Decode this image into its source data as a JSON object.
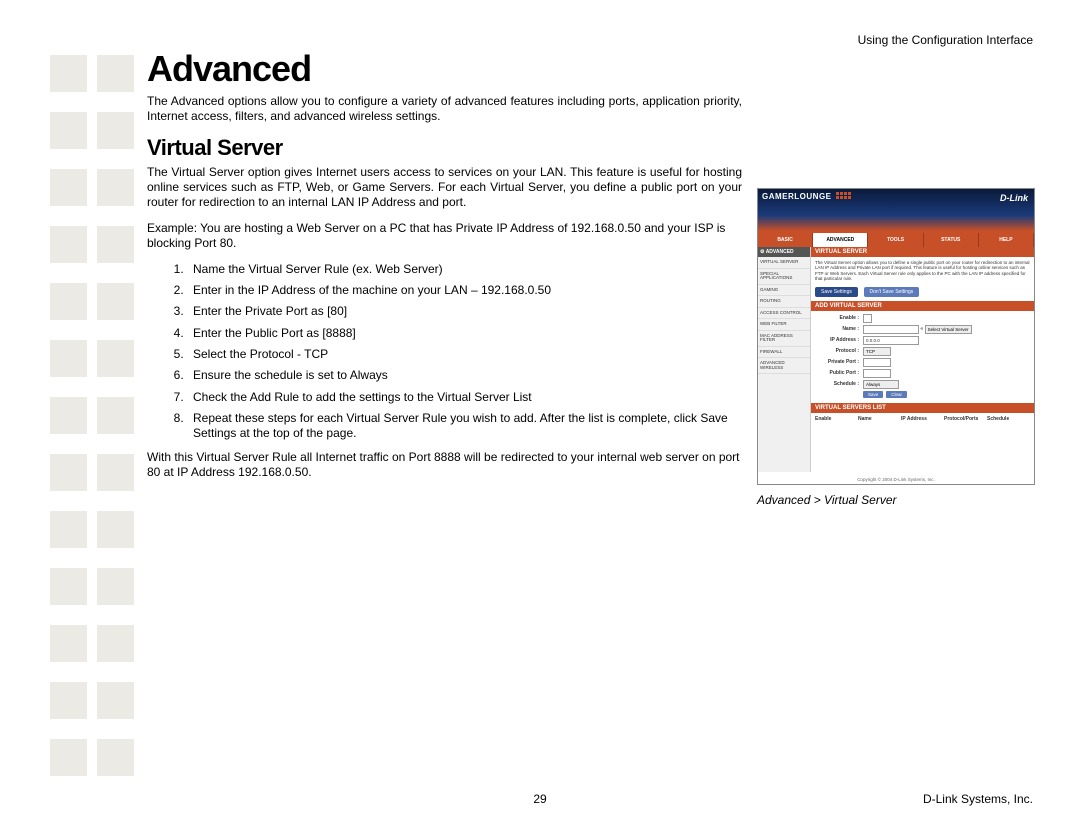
{
  "header": {
    "right": "Using the Configuration Interface"
  },
  "title": "Advanced",
  "intro": "The Advanced options allow you to configure a variety of advanced features including ports, application priority, Internet access, filters, and advanced wireless settings.",
  "section_title": "Virtual Server",
  "vs_p1": "The Virtual Server option gives Internet users access to services on your LAN. This feature is useful for hosting online services such as FTP, Web, or Game Servers. For each Virtual Server, you define a public port on your router for redirection to an internal LAN IP Address and port.",
  "vs_p2": "Example: You are hosting a Web Server on a PC that has Private IP Address of 192.168.0.50 and your ISP is blocking Port 80.",
  "steps": [
    "Name the Virtual Server Rule (ex. Web Server)",
    "Enter in the IP Address of the machine on your LAN – 192.168.0.50",
    "Enter the Private Port as [80]",
    "Enter the Public Port as [8888]",
    "Select the Protocol - TCP",
    "Ensure the schedule is set to Always",
    "Check the Add Rule to add the settings to the Virtual Server List",
    "Repeat these steps for each Virtual Server Rule you wish to add. After the list is complete, click Save Settings at the top of the page."
  ],
  "vs_p3": "With this Virtual Server Rule all Internet traffic on Port 8888 will be redirected to your internal web server on port 80 at IP Address 192.168.0.50.",
  "caption": "Advanced > Virtual Server",
  "footer": {
    "page": "29",
    "company": "D-Link Systems, Inc."
  },
  "shot": {
    "logo": "GAMERLOUNGE",
    "brand": "D-Link",
    "tabs": [
      "BASIC",
      "ADVANCED",
      "TOOLS",
      "STATUS",
      "HELP"
    ],
    "active_tab": 1,
    "side_head": "ADVANCED",
    "side_items": [
      "VIRTUAL SERVER",
      "SPECIAL APPLICATIONS",
      "GAMING",
      "ROUTING",
      "ACCESS CONTROL",
      "WEB FILTER",
      "MAC ADDRESS FILTER",
      "FIREWALL",
      "ADVANCED WIRELESS"
    ],
    "bar1": "VIRTUAL SERVER",
    "desc": "The Virtual Server option allows you to define a single public port on your router for redirection to an internal LAN IP Address and Private LAN port if required. This feature is useful for hosting online services such as FTP or Web Servers. Each Virtual Server rule only applies to the PC with the LAN IP address specified for that particular rule.",
    "save": "Save Settings",
    "dont": "Don't Save Settings",
    "bar2": "ADD VIRTUAL SERVER",
    "form": {
      "enable": "Enable :",
      "name": "Name :",
      "name_sel": "Select Virtual Server",
      "ip": "IP Address :",
      "ip_val": "0.0.0.0",
      "proto": "Protocol :",
      "proto_val": "TCP",
      "priv": "Private Port :",
      "pub": "Public Port :",
      "sched": "Schedule :",
      "sched_val": "Always",
      "save_btn": "Save",
      "clear_btn": "Clear"
    },
    "bar3": "VIRTUAL SERVERS LIST",
    "list_hdrs": [
      "Enable",
      "Name",
      "IP Address",
      "Protocol/Ports",
      "Schedule"
    ],
    "copyright": "Copyright © 2004 D-Link Systems, Inc."
  }
}
